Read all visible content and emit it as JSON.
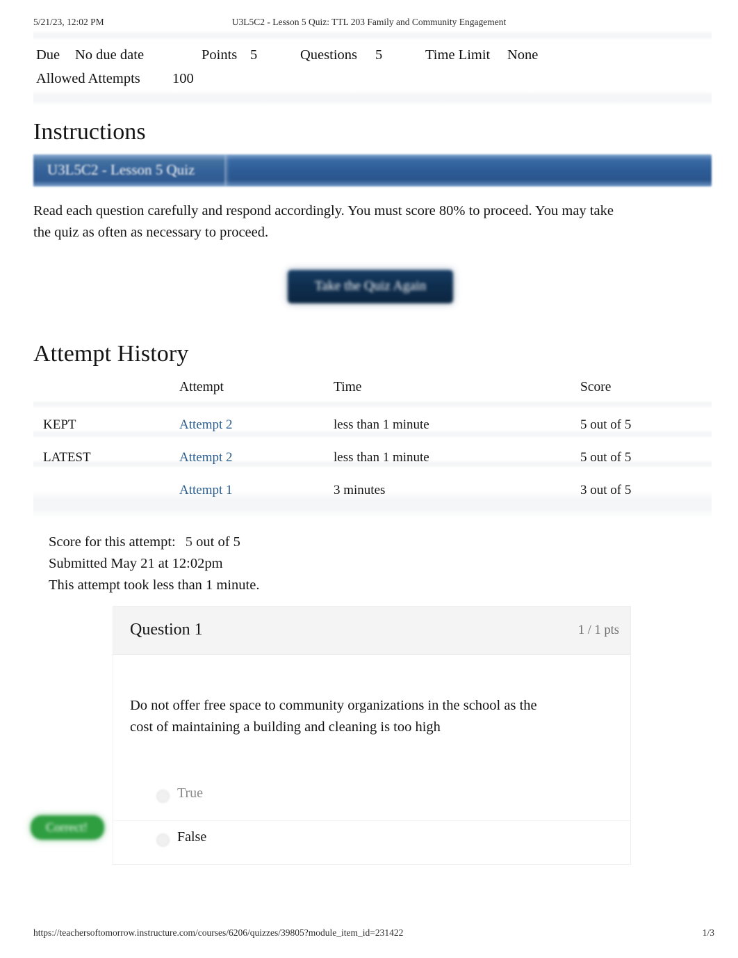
{
  "print_header": {
    "date": "5/21/23, 12:02 PM",
    "title": "U3L5C2 - Lesson 5 Quiz: TTL 203 Family and Community Engagement"
  },
  "quiz_meta": {
    "due_label": "Due",
    "due_value": "No due date",
    "points_label": "Points",
    "points_value": "5",
    "questions_label": "Questions",
    "questions_value": "5",
    "time_limit_label": "Time Limit",
    "time_limit_value": "None",
    "allowed_attempts_label": "Allowed Attempts",
    "allowed_attempts_value": "100"
  },
  "instructions": {
    "heading": "Instructions",
    "banner_title": "U3L5C2 - Lesson 5 Quiz",
    "body": "Read each question carefully and respond accordingly. You must score 80% to proceed. You may take the quiz as often as necessary to proceed.",
    "take_quiz_button": "Take the Quiz Again"
  },
  "attempt_history": {
    "heading": "Attempt History",
    "columns": [
      "",
      "Attempt",
      "Time",
      "Score"
    ],
    "rows": [
      {
        "flag": "KEPT",
        "attempt": "Attempt 2",
        "time": "less than 1 minute",
        "score": "5 out of 5"
      },
      {
        "flag": "LATEST",
        "attempt": "Attempt 2",
        "time": "less than 1 minute",
        "score": "5 out of 5"
      },
      {
        "flag": "",
        "attempt": "Attempt 1",
        "time": "3 minutes",
        "score": "3 out of 5"
      }
    ]
  },
  "attempt_summary": {
    "score_label": "Score for this attempt:",
    "score_number": "5",
    "score_rest": "out of 5",
    "submitted": "Submitted May 21 at 12:02pm",
    "duration": "This attempt took less than 1 minute."
  },
  "question": {
    "title": "Question 1",
    "points": "1 / 1 pts",
    "text": "Do not offer free space to community organizations in the school as the cost of maintaining a building and cleaning is too high",
    "options": [
      {
        "label": "True",
        "selected": false
      },
      {
        "label": "False",
        "selected": true
      }
    ],
    "feedback_badge": "Correct!"
  },
  "print_footer": {
    "url": "https://teachersoftomorrow.instructure.com/courses/6206/quizzes/39805?module_item_id=231422",
    "page": "1/3"
  },
  "colors": {
    "banner_blue": "#2d5c96",
    "button_navy": "#0f2e4f",
    "link_blue": "#2b5e8f",
    "correct_green": "#2e9e40",
    "question_header_gray": "#f4f4f5"
  }
}
